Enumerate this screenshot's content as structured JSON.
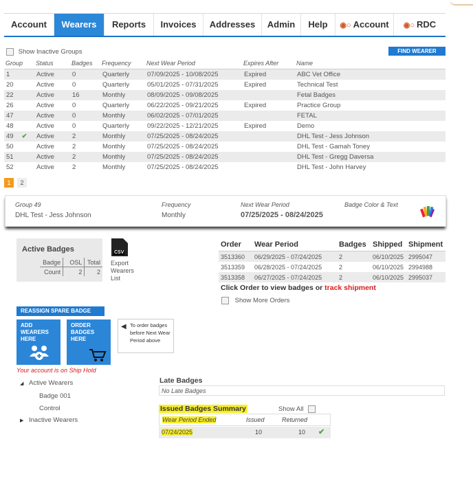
{
  "nav": {
    "tabs": [
      {
        "label": "Account",
        "active": false,
        "icon": ""
      },
      {
        "label": "Wearers",
        "active": true,
        "icon": ""
      },
      {
        "label": "Reports",
        "active": false,
        "icon": ""
      },
      {
        "label": "Invoices",
        "active": false,
        "icon": ""
      },
      {
        "label": "Addresses",
        "active": false,
        "icon": ""
      },
      {
        "label": "Admin",
        "active": false,
        "icon": ""
      },
      {
        "label": "Help",
        "active": false,
        "icon": ""
      },
      {
        "label": "Account",
        "active": false,
        "icon": "users-icon"
      },
      {
        "label": "RDC",
        "active": false,
        "icon": "users-icon"
      }
    ]
  },
  "groups": {
    "show_inactive_label": "Show Inactive Groups",
    "find_wearer_label": "FIND WEARER",
    "headers": [
      "Group",
      "Status",
      "Badges",
      "Frequency",
      "Next Wear Period",
      "Expires After",
      "Name"
    ],
    "rows": [
      {
        "group": "1",
        "check": false,
        "status": "Active",
        "badges": "0",
        "frequency": "Quarterly",
        "period": "07/09/2025 - 10/08/2025",
        "expires": "Expired",
        "name": "ABC Vet Office"
      },
      {
        "group": "20",
        "check": false,
        "status": "Active",
        "badges": "0",
        "frequency": "Quarterly",
        "period": "05/01/2025 - 07/31/2025",
        "expires": "Expired",
        "name": "Technical Test"
      },
      {
        "group": "22",
        "check": false,
        "status": "Active",
        "badges": "16",
        "frequency": "Monthly",
        "period": "08/09/2025 - 09/08/2025",
        "expires": "",
        "name": "Fetal Badges"
      },
      {
        "group": "26",
        "check": false,
        "status": "Active",
        "badges": "0",
        "frequency": "Quarterly",
        "period": "06/22/2025 - 09/21/2025",
        "expires": "Expired",
        "name": "Practice Group"
      },
      {
        "group": "47",
        "check": false,
        "status": "Active",
        "badges": "0",
        "frequency": "Monthly",
        "period": "06/02/2025 - 07/01/2025",
        "expires": "",
        "name": "FETAL"
      },
      {
        "group": "48",
        "check": false,
        "status": "Active",
        "badges": "0",
        "frequency": "Quarterly",
        "period": "09/22/2025 - 12/21/2025",
        "expires": "Expired",
        "name": "Demo"
      },
      {
        "group": "49",
        "check": true,
        "status": "Active",
        "badges": "2",
        "frequency": "Monthly",
        "period": "07/25/2025 - 08/24/2025",
        "expires": "",
        "name": "DHL Test - Jess Johnson"
      },
      {
        "group": "50",
        "check": false,
        "status": "Active",
        "badges": "2",
        "frequency": "Monthly",
        "period": "07/25/2025 - 08/24/2025",
        "expires": "",
        "name": "DHL Test - Gamah Toney"
      },
      {
        "group": "51",
        "check": false,
        "status": "Active",
        "badges": "2",
        "frequency": "Monthly",
        "period": "07/25/2025 - 08/24/2025",
        "expires": "",
        "name": "DHL Test - Gregg Daversa"
      },
      {
        "group": "52",
        "check": false,
        "status": "Active",
        "badges": "2",
        "frequency": "Monthly",
        "period": "07/25/2025 - 08/24/2025",
        "expires": "",
        "name": "DHL Test - John Harvey"
      }
    ],
    "pages": [
      "1",
      "2"
    ]
  },
  "detail": {
    "group_label": "Group 49",
    "group_value": "DHL Test - Jess Johnson",
    "frequency_label": "Frequency",
    "frequency_value": "Monthly",
    "next_label": "Next Wear Period",
    "next_value": "07/25/2025 - 08/24/2025",
    "badge_color_label": "Badge Color & Text"
  },
  "active_badges": {
    "title": "Active Badges",
    "col_badge": "Badge",
    "col_osl": "OSL",
    "col_total": "Total",
    "row_label": "Count",
    "osl": "2",
    "total": "2",
    "csv_label": "CSV",
    "export_label": "Export Wearers List"
  },
  "orders": {
    "headers": [
      "Order",
      "Wear Period",
      "Badges",
      "Shipped",
      "Shipment"
    ],
    "rows": [
      {
        "order": "3513360",
        "period": "06/29/2025 - 07/24/2025",
        "badges": "2",
        "shipped": "06/10/2025",
        "shipment": "2995047"
      },
      {
        "order": "3513359",
        "period": "06/28/2025 - 07/24/2025",
        "badges": "2",
        "shipped": "06/10/2025",
        "shipment": "2994988"
      },
      {
        "order": "3513358",
        "period": "06/27/2025 - 07/24/2025",
        "badges": "2",
        "shipped": "06/10/2025",
        "shipment": "2995037"
      }
    ],
    "hint_prefix": "Click Order to view badges or ",
    "hint_link": "track shipment",
    "show_more": "Show More Orders"
  },
  "actions": {
    "reassign": "REASSIGN SPARE BADGE",
    "add_wearers": "ADD WEARERS HERE",
    "order_badges": "ORDER BADGES HERE",
    "tooltip": "To order badges before Next Wear Period above",
    "ship_hold": "Your account is on Ship Hold"
  },
  "tree": {
    "active": "Active Wearers",
    "badge": "Badge 001",
    "control": "Control",
    "inactive": "Inactive Wearers"
  },
  "late": {
    "title": "Late Badges",
    "value": "No Late Badges"
  },
  "summary": {
    "title": "Issued Badges Summary",
    "show_all": "Show All",
    "headers": [
      "Wear Period Ended",
      "Issued",
      "Returned"
    ],
    "row": {
      "ended": "07/24/2025",
      "issued": "10",
      "returned": "10"
    }
  },
  "colors": {
    "accent": "#2b87d7",
    "alert": "#d91c1c",
    "pager": "#f39a1d",
    "highlight": "#f7ee2a"
  }
}
